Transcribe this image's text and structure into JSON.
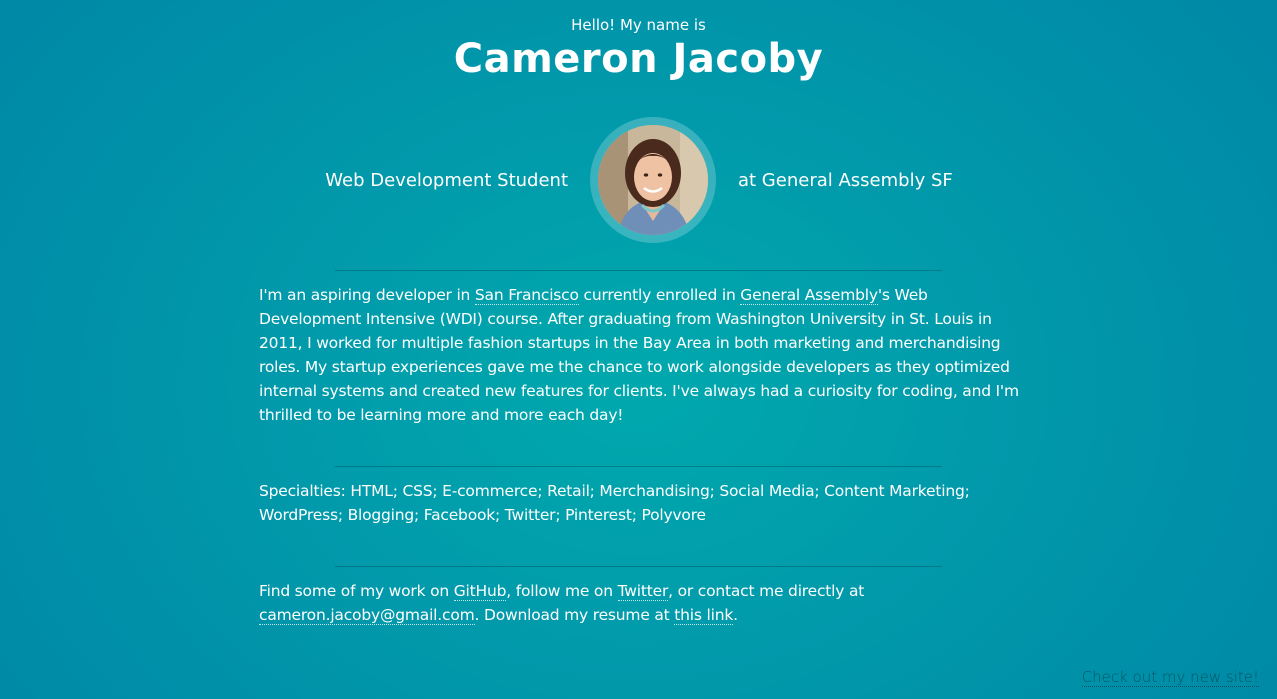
{
  "header": {
    "intro": "Hello! My name is",
    "name": "Cameron Jacoby"
  },
  "tagline": {
    "left": "Web Development Student",
    "right": "at General Assembly SF"
  },
  "avatar": {
    "icon": "profile-photo"
  },
  "bio": {
    "t1": "I'm an aspiring developer in ",
    "link_city": "San Francisco",
    "t2": " currently enrolled in ",
    "link_ga": "General Assembly",
    "t3": "'s Web Development Intensive (WDI) course. After graduating from Washington University in St. Louis in 2011, I worked for multiple fashion startups in the Bay Area in both marketing and merchandising roles. My startup experiences gave me the chance to work alongside developers as they optimized internal systems and created new features for clients. I've always had a curiosity for coding, and I'm thrilled to be learning more and more each day!"
  },
  "specialties": {
    "text": "Specialties: HTML; CSS; E-commerce; Retail; Merchandising; Social Media; Content Marketing; WordPress; Blogging; Facebook; Twitter; Pinterest; Polyvore"
  },
  "contact": {
    "t1": "Find some of my work on ",
    "link_github": "GitHub",
    "t2": ", follow me on ",
    "link_twitter": "Twitter",
    "t3": ", or contact me directly at ",
    "link_email": "cameron.jacoby@gmail.com",
    "t4": ". Download my resume at ",
    "link_resume": "this link",
    "t5": "."
  },
  "footer": {
    "new_site": "Check out my new site!"
  },
  "colors": {
    "background_center": "#00a9ad",
    "background_edge": "#0089a6",
    "text": "#ffffff"
  }
}
